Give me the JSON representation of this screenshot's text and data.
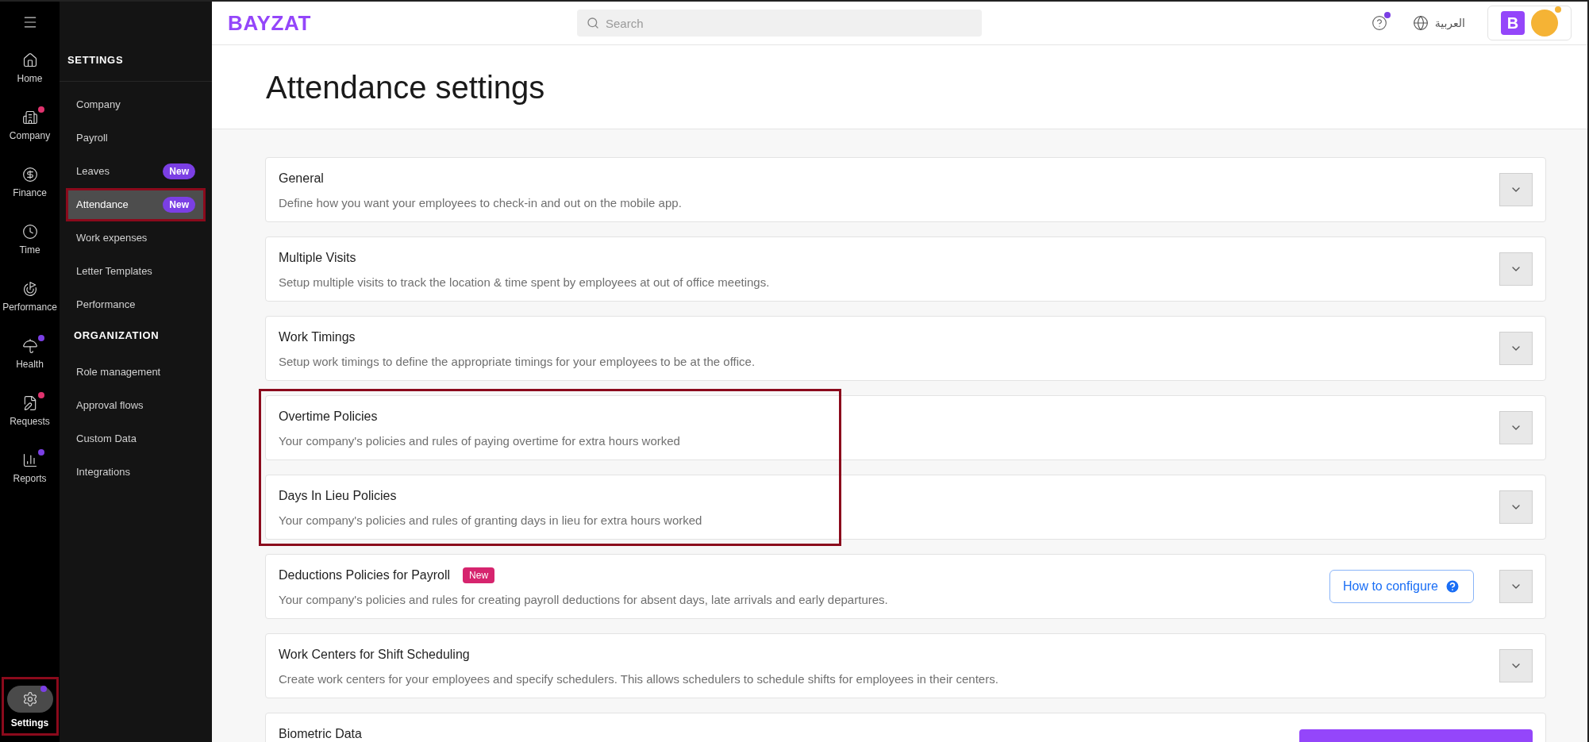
{
  "rail": {
    "items": [
      {
        "label": "Home",
        "selected": false
      },
      {
        "label": "Company",
        "selected": false,
        "color": "#e0336e"
      },
      {
        "label": "Finance",
        "selected": false
      },
      {
        "label": "Time",
        "selected": false
      },
      {
        "label": "Performance",
        "selected": false
      },
      {
        "label": "Health",
        "selected": false,
        "color": "#7b3fe4"
      },
      {
        "label": "Requests",
        "selected": false,
        "color": "#e0336e"
      },
      {
        "label": "Reports",
        "selected": false,
        "color": "#7b3fe4"
      }
    ],
    "settings": {
      "label": "Settings",
      "selected": true,
      "highlighted": true,
      "color": "#7b3fe4"
    }
  },
  "submenu": {
    "sections": [
      {
        "heading": "SETTINGS",
        "items": [
          {
            "label": "Company",
            "selected": false,
            "highlighted": false
          },
          {
            "label": "Payroll",
            "selected": false,
            "highlighted": false
          },
          {
            "label": "Leaves",
            "selected": false,
            "highlighted": false,
            "badge": "New"
          },
          {
            "label": "Attendance",
            "selected": true,
            "highlighted": true,
            "badge": "New"
          },
          {
            "label": "Work expenses",
            "selected": false,
            "highlighted": false
          },
          {
            "label": "Letter Templates",
            "selected": false,
            "highlighted": false
          },
          {
            "label": "Performance",
            "selected": false,
            "highlighted": false
          }
        ]
      },
      {
        "heading": "ORGANIZATION",
        "items": [
          {
            "label": "Role management",
            "selected": false,
            "highlighted": false
          },
          {
            "label": "Approval flows",
            "selected": false,
            "highlighted": false
          },
          {
            "label": "Custom Data",
            "selected": false,
            "highlighted": false
          },
          {
            "label": "Integrations",
            "selected": false,
            "highlighted": false
          }
        ]
      }
    ]
  },
  "topbar": {
    "logo": "BAYZAT",
    "search": {
      "placeholder": "Search"
    },
    "language": "العربية",
    "company_logo": "B"
  },
  "page": {
    "title": "Attendance settings"
  },
  "cards": [
    {
      "title": "General",
      "description": "Define how you want your employees to check-in and out on the mobile app.",
      "highlighted": false
    },
    {
      "title": "Multiple Visits",
      "description": "Setup multiple visits to track the location & time spent by employees at out of office meetings.",
      "highlighted": false
    },
    {
      "title": "Work Timings",
      "description": "Setup work timings to define the appropriate timings for your employees to be at the office.",
      "highlighted": false
    },
    {
      "title": "Overtime Policies",
      "description": "Your company's policies and rules of paying overtime for extra hours worked",
      "highlighted": true
    },
    {
      "title": "Days In Lieu Policies",
      "description": "Your company's policies and rules of granting days in lieu for extra hours worked",
      "highlighted": true
    },
    {
      "title": "Deductions Policies for Payroll",
      "badge": "New",
      "description": "Your company's policies and rules for creating payroll deductions for absent days, late arrivals and early departures.",
      "highlighted": false,
      "help_button": "How to configure"
    },
    {
      "title": "Work Centers for Shift Scheduling",
      "description": "Create work centers for your employees and specify schedulers. This allows schedulers to schedule shifts for employees in their centers.",
      "highlighted": false
    },
    {
      "title": "Biometric Data",
      "highlighted": false,
      "action_button": true
    }
  ]
}
